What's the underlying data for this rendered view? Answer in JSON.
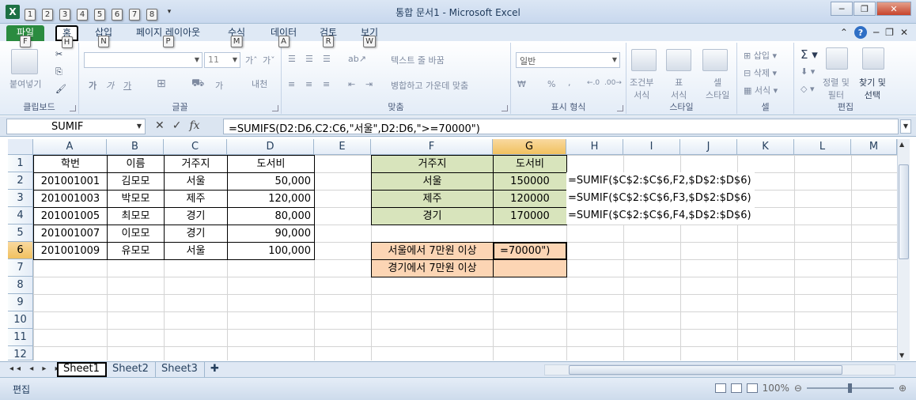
{
  "window": {
    "title": "통합 문서1 - Microsoft Excel",
    "minimize": "─",
    "restore": "❐",
    "close": "✕"
  },
  "qat": {
    "keytips": [
      "1",
      "2",
      "3",
      "4",
      "5",
      "6",
      "7",
      "8"
    ]
  },
  "tabs": [
    {
      "label": "파일",
      "keytip": "F"
    },
    {
      "label": "홈",
      "keytip": "H"
    },
    {
      "label": "삽입",
      "keytip": "N"
    },
    {
      "label": "페이지 레이아웃",
      "keytip": "P"
    },
    {
      "label": "수식",
      "keytip": "M"
    },
    {
      "label": "데이터",
      "keytip": "A"
    },
    {
      "label": "검토",
      "keytip": "R"
    },
    {
      "label": "보기",
      "keytip": "W"
    }
  ],
  "ribbon": {
    "clipboard": {
      "label": "클립보드",
      "paste": "붙여넣기"
    },
    "font": {
      "label": "글꼴",
      "size": "11",
      "bold": "가",
      "italic": "가",
      "underline": "가",
      "cell_style": "내천"
    },
    "alignment": {
      "label": "맞춤",
      "wrap": "텍스트 줄 바꿈",
      "merge": "병합하고 가운데 맞춤"
    },
    "number": {
      "label": "표시 형식",
      "format": "일반",
      "percent": "%",
      "comma": ","
    },
    "styles": {
      "label": "스타일",
      "cond": "조건부\n서식",
      "table": "표\n서식",
      "cellstyle": "셀\n스타일"
    },
    "cells": {
      "label": "셀",
      "insert": "삽입",
      "delete": "삭제",
      "format": "서식"
    },
    "editing": {
      "label": "편집",
      "sort": "정렬 및\n필터",
      "find": "찾기 및\n선택"
    }
  },
  "formula_bar": {
    "name_box": "SUMIF",
    "cancel": "✕",
    "enter": "✓",
    "fx": "fx",
    "formula": "=SUMIFS(D2:D6,C2:C6,\"서울\",D2:D6,\">=70000\")"
  },
  "columns": [
    "A",
    "B",
    "C",
    "D",
    "E",
    "F",
    "G",
    "H",
    "I",
    "J",
    "K",
    "L",
    "M"
  ],
  "rows": [
    "1",
    "2",
    "3",
    "4",
    "5",
    "6",
    "7",
    "8",
    "9",
    "10",
    "11",
    "12"
  ],
  "cells": {
    "A1": "학번",
    "B1": "이름",
    "C1": "거주지",
    "D1": "도서비",
    "A2": "201001001",
    "B2": "김모모",
    "C2": "서울",
    "D2": "50,000",
    "A3": "201001003",
    "B3": "박모모",
    "C3": "제주",
    "D3": "120,000",
    "A4": "201001005",
    "B4": "최모모",
    "C4": "경기",
    "D4": "80,000",
    "A5": "201001007",
    "B5": "이모모",
    "C5": "경기",
    "D5": "90,000",
    "A6": "201001009",
    "B6": "유모모",
    "C6": "서울",
    "D6": "100,000",
    "F1": "거주지",
    "G1": "도서비",
    "F2": "서울",
    "G2": "150000",
    "F3": "제주",
    "G3": "120000",
    "F4": "경기",
    "G4": "170000",
    "H2": "=SUMIF($C$2:$C$6,F2,$D$2:$D$6)",
    "H3": "=SUMIF($C$2:$C$6,F3,$D$2:$D$6)",
    "H4": "=SUMIF($C$2:$C$6,F4,$D$2:$D$6)",
    "F6": "서울에서 7만원 이상",
    "G6": "=70000\")",
    "F7": "경기에서 7만원 이상",
    "G7": ""
  },
  "sheet_tabs": [
    "Sheet1",
    "Sheet2",
    "Sheet3"
  ],
  "status": {
    "mode": "편집",
    "zoom": "100%"
  }
}
